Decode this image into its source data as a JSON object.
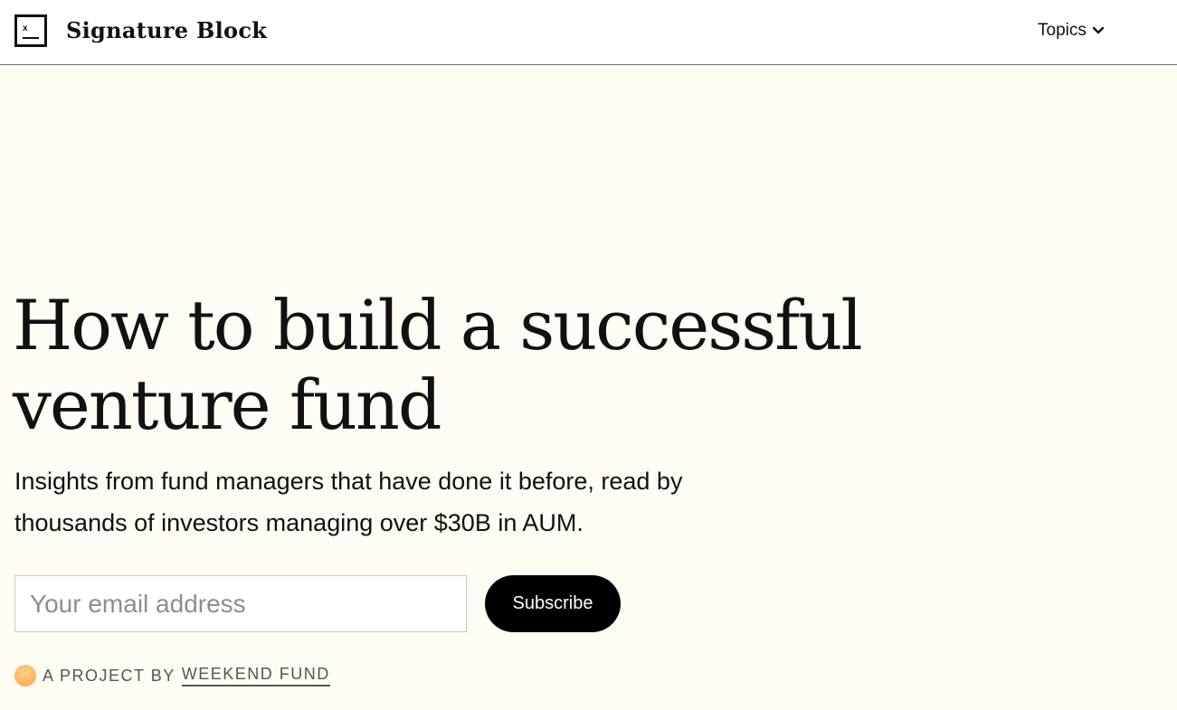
{
  "header": {
    "brand": "Signature Block",
    "logo_mark_letter": "x",
    "topics_label": "Topics",
    "topics_icon": "chevron-down-icon"
  },
  "hero": {
    "title": "How to build a successful venture fund",
    "subtitle": "Insights from fund managers that have done it before, read by thousands of investors managing over $30B in AUM."
  },
  "form": {
    "email_placeholder": "Your email address",
    "email_value": "",
    "subscribe_label": "Subscribe"
  },
  "footer": {
    "project_label": "A PROJECT BY",
    "fund_link": "WEEKEND FUND",
    "icon": "sun-icon"
  },
  "colors": {
    "background": "#fffcf4",
    "header_background": "#ffffff",
    "text": "#111111",
    "button": "#000000",
    "muted_text": "#555555",
    "sun_accent": "#ffb764"
  }
}
